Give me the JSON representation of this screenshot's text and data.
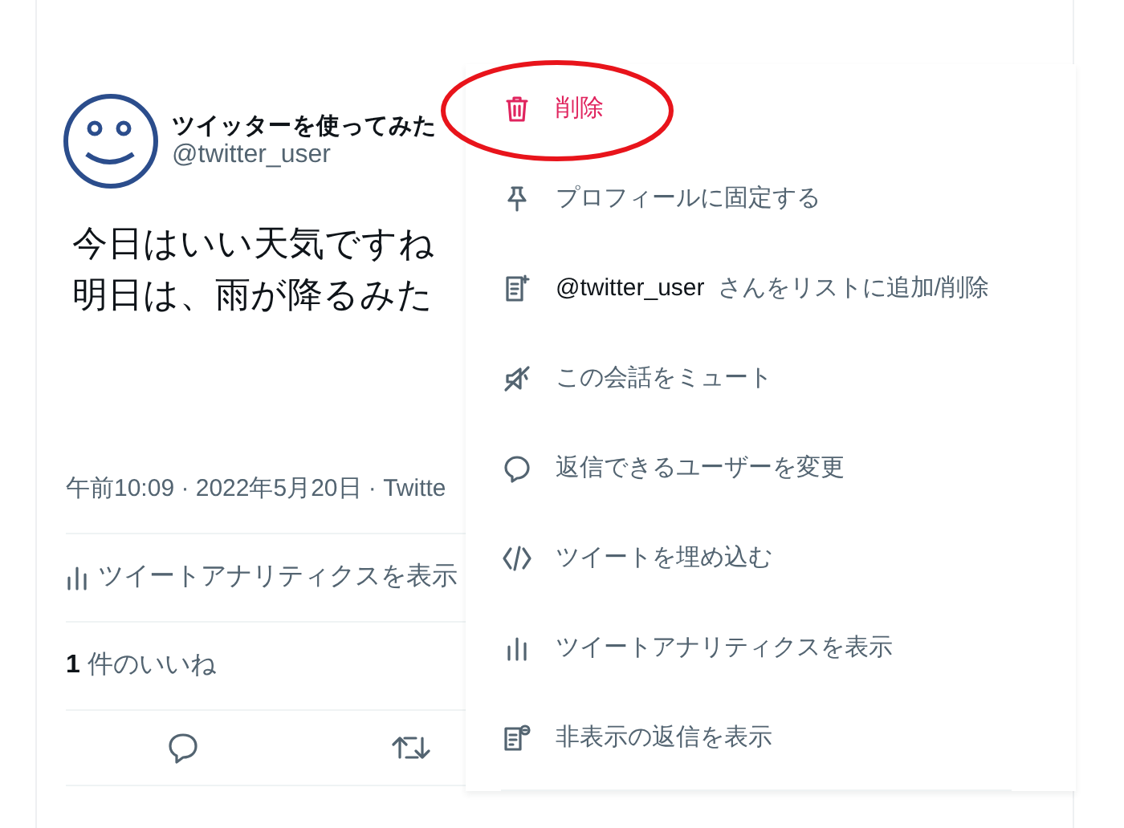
{
  "tweet": {
    "display_name": "ツイッターを使ってみた",
    "handle": "@twitter_user",
    "body": [
      "今日はいい天気ですね",
      "明日は、雨が降るみた"
    ],
    "meta": "午前10:09 · 2022年5月20日 · Twitte",
    "analytics": "ツイートアナリティクスを表示",
    "likes": "**1** 件のいいね"
  },
  "menu": {
    "items": [
      {
        "kind": "danger",
        "label": "削除"
      },
      {
        "kind": "normal",
        "label": "プロフィールに固定する"
      },
      {
        "kind": "normal",
        "handle": "@twitter_user",
        "label": "さんをリストに追加/削除"
      },
      {
        "kind": "normal",
        "label": "この会話をミュート"
      },
      {
        "kind": "normal",
        "label": "返信できるユーザーを変更"
      },
      {
        "kind": "normal",
        "label": "ツイートを埋め込む"
      },
      {
        "kind": "normal",
        "label": "ツイートアナリティクスを表示"
      },
      {
        "kind": "normal",
        "label": "非表示の返信を表示"
      }
    ]
  }
}
